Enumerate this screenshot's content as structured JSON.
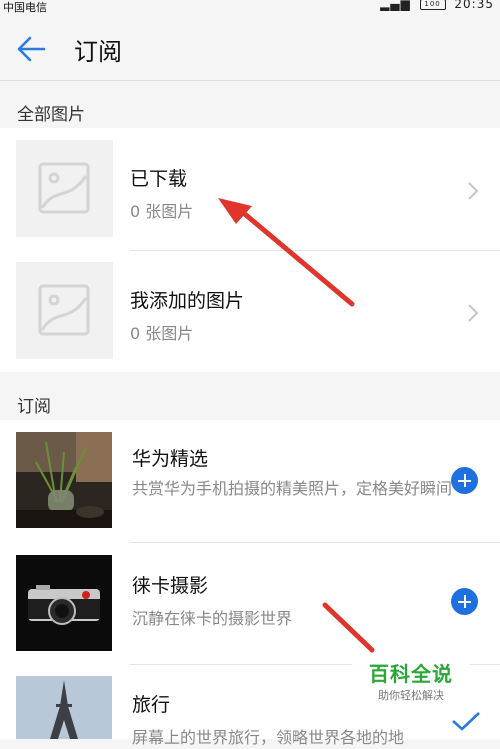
{
  "status_bar": {
    "carrier": "中国电信",
    "battery": "100",
    "time": "20:35"
  },
  "header": {
    "title": "订阅"
  },
  "section_all": {
    "label": "全部图片",
    "items": [
      {
        "title": "已下载",
        "count": "0 张图片"
      },
      {
        "title": "我添加的图片",
        "count": "0 张图片"
      }
    ]
  },
  "section_subscriptions": {
    "label": "订阅",
    "items": [
      {
        "title": "华为精选",
        "desc": "共赏华为手机拍摄的精美照片，定格美好瞬间"
      },
      {
        "title": "徕卡摄影",
        "desc": "沉静在徕卡的摄影世界"
      },
      {
        "title": "旅行",
        "desc": "屏幕上的世界旅行，领略世界各地的地"
      }
    ]
  },
  "watermark": {
    "logo": "百科全说",
    "sub": "助你轻松解决"
  },
  "colors": {
    "accent": "#1e6fe0",
    "annotation_arrow": "#e0352b",
    "watermark_green": "#2aa837"
  },
  "icons": [
    "back-arrow-icon",
    "image-placeholder-icon",
    "chevron-right-icon",
    "plus-icon",
    "check-icon"
  ]
}
